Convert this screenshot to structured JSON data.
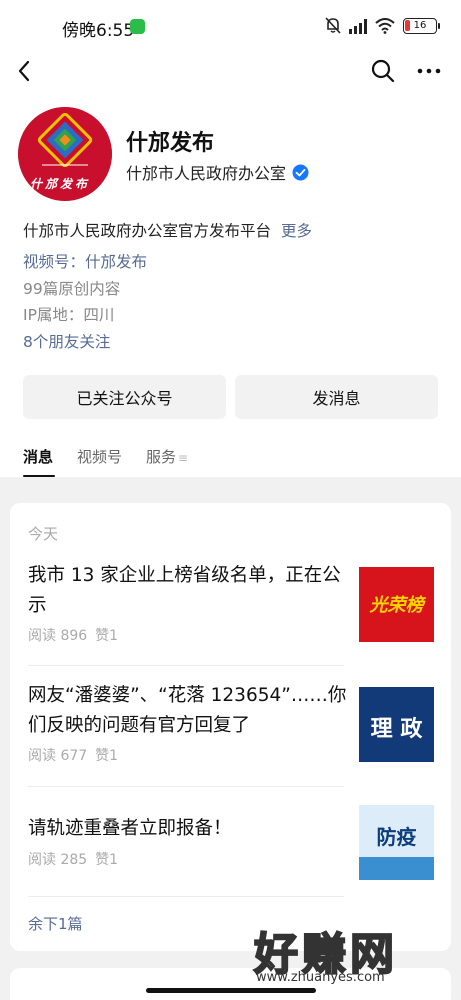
{
  "status_bar": {
    "time": "傍晚6:55",
    "battery": "16"
  },
  "profile": {
    "name": "什邡发布",
    "owner": "什邡市人民政府办公室",
    "description": "什邡市人民政府办公室官方发布平台",
    "more_label": "更多",
    "channel": "视频号：什邡发布",
    "original_count": "99篇原创内容",
    "ip_location": "IP属地：四川",
    "friends_following": "8个朋友关注"
  },
  "actions": {
    "followed_label": "已关注公众号",
    "message_label": "发消息"
  },
  "tabs": [
    "消息",
    "视频号",
    "服务"
  ],
  "feed": {
    "date_label": "今天",
    "articles": [
      {
        "title": "我市 13 家企业上榜省级名单，正在公示",
        "reads": "阅读 896",
        "likes": "赞1",
        "thumb_text": "光荣榜"
      },
      {
        "title": "网友“潘婆婆”、“花落 123654”……你们反映的问题有官方回复了",
        "reads": "阅读 677",
        "likes": "赞1",
        "thumb_text": "理 政"
      },
      {
        "title": "请轨迹重叠者立即报备！",
        "reads": "阅读 285",
        "likes": "赞1",
        "thumb_text": "防疫"
      }
    ],
    "remaining_label": "余下1篇"
  },
  "avatar_text": "什邡发布",
  "watermark": {
    "text": "好赚网",
    "url": "www.zhuanyes.com"
  },
  "colors": {
    "link": "#576b95",
    "brand_red": "#c8102e",
    "verified": "#1677ff"
  }
}
